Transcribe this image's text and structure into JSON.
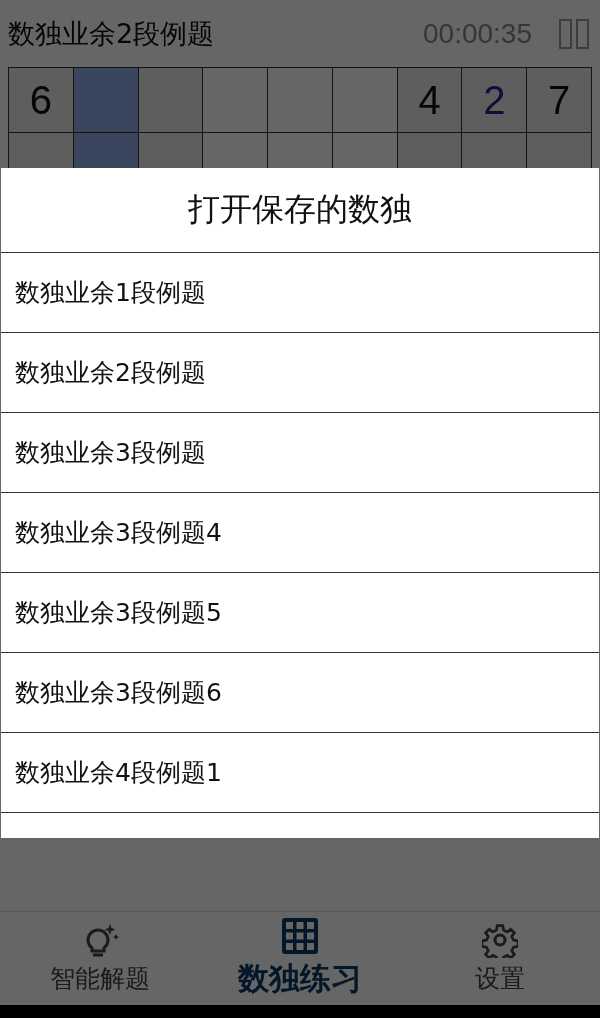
{
  "header": {
    "title": "数独业余2段例题",
    "timer": "00:00:35"
  },
  "grid": {
    "rows": [
      [
        {
          "value": "6",
          "entered": false,
          "selected": false
        },
        {
          "selected": true
        },
        {
          "selected": false
        },
        {
          "selected": false
        },
        {
          "selected": false
        },
        {
          "selected": false
        },
        {
          "value": "4",
          "entered": false,
          "selected": false
        },
        {
          "value": "2",
          "entered": true,
          "selected": false
        },
        {
          "value": "7",
          "entered": false,
          "selected": false
        }
      ],
      [
        {
          "selected": false
        },
        {
          "selected": true
        },
        {
          "selected": false
        },
        {
          "selected": false
        },
        {
          "selected": false
        },
        {
          "selected": false
        },
        {
          "selected": false
        },
        {
          "selected": false
        },
        {
          "selected": false
        }
      ]
    ]
  },
  "dialog": {
    "title": "打开保存的数独",
    "items": [
      "数独业余1段例题",
      "数独业余2段例题",
      "数独业余3段例题",
      "数独业余3段例题4",
      "数独业余3段例题5",
      "数独业余3段例题6",
      "数独业余4段例题1"
    ]
  },
  "nav": [
    {
      "label": "智能解题",
      "kind": "bulb",
      "selected": false
    },
    {
      "label": "数独练习",
      "kind": "grid",
      "selected": true
    },
    {
      "label": "设置",
      "kind": "gear",
      "selected": false
    }
  ]
}
